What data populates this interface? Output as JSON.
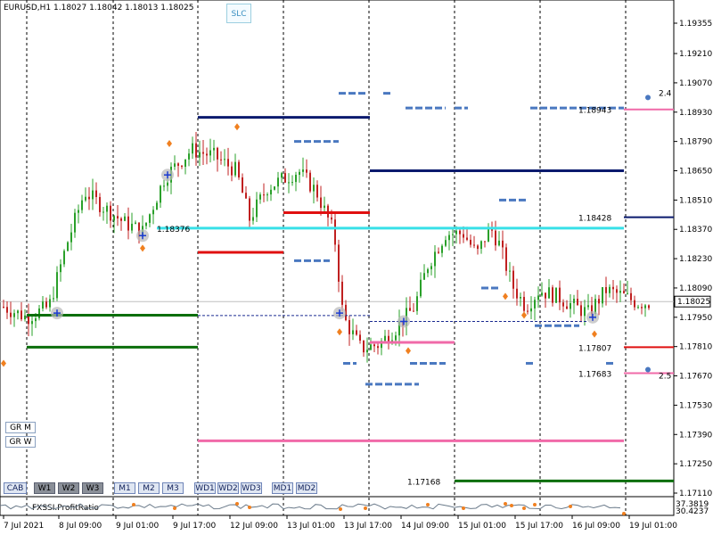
{
  "header": {
    "symbol": "EURUSD,H1",
    "ohlc": "1.18027 1.18042 1.18013 1.18025",
    "slc_button": "SLC"
  },
  "price_axis": {
    "ticks": [
      "1.19355",
      "1.19210",
      "1.19070",
      "1.18930",
      "1.18790",
      "1.18650",
      "1.18510",
      "1.18370",
      "1.18230",
      "1.18090",
      "1.17950",
      "1.17810",
      "1.17670",
      "1.17530",
      "1.17390",
      "1.17250",
      "1.17110"
    ],
    "current_price": "1.18025",
    "current_price_color": "#000000"
  },
  "time_axis": {
    "ticks": [
      "7 Jul 2021",
      "8 Jul 09:00",
      "9 Jul 01:00",
      "9 Jul 17:00",
      "12 Jul 09:00",
      "13 Jul 01:00",
      "13 Jul 17:00",
      "14 Jul 09:00",
      "15 Jul 01:00",
      "15 Jul 17:00",
      "16 Jul 09:00",
      "19 Jul 01:00"
    ]
  },
  "level_labels": {
    "pink_high": "1.18943",
    "cyan_left": "1.18376",
    "navy": "1.18428",
    "red": "1.17807",
    "pink_low": "1.17683",
    "green": "1.17168",
    "dot_top": "2.4",
    "dot_low": "2.5"
  },
  "colors": {
    "navy": "#0a1a6e",
    "red": "#e01010",
    "green": "#0a6e0a",
    "pink": "#f06aa8",
    "cyan": "#38e0e8",
    "blue": "#4a78c0",
    "candle_up": "#2aa02a",
    "candle_down": "#c02020",
    "grid": "#000000"
  },
  "left_buttons": {
    "gr_m": "GR M",
    "gr_w": "GR W"
  },
  "bottom_buttons": [
    {
      "label": "CAB",
      "style": "navy"
    },
    {
      "label": "W1",
      "style": "dark"
    },
    {
      "label": "W2",
      "style": "dark"
    },
    {
      "label": "W3",
      "style": "dark"
    },
    {
      "label": "M1",
      "style": "navy"
    },
    {
      "label": "M2",
      "style": "navy"
    },
    {
      "label": "M3",
      "style": "navy"
    },
    {
      "label": "WD1",
      "style": "navy"
    },
    {
      "label": "WD2",
      "style": "navy"
    },
    {
      "label": "WD3",
      "style": "navy"
    },
    {
      "label": "MD1",
      "style": "navy"
    },
    {
      "label": "MD2",
      "style": "navy"
    }
  ],
  "indicator": {
    "name": "FXSSI.ProfitRatio",
    "upper_value": "37.3819",
    "lower_value": "30.4237"
  }
}
